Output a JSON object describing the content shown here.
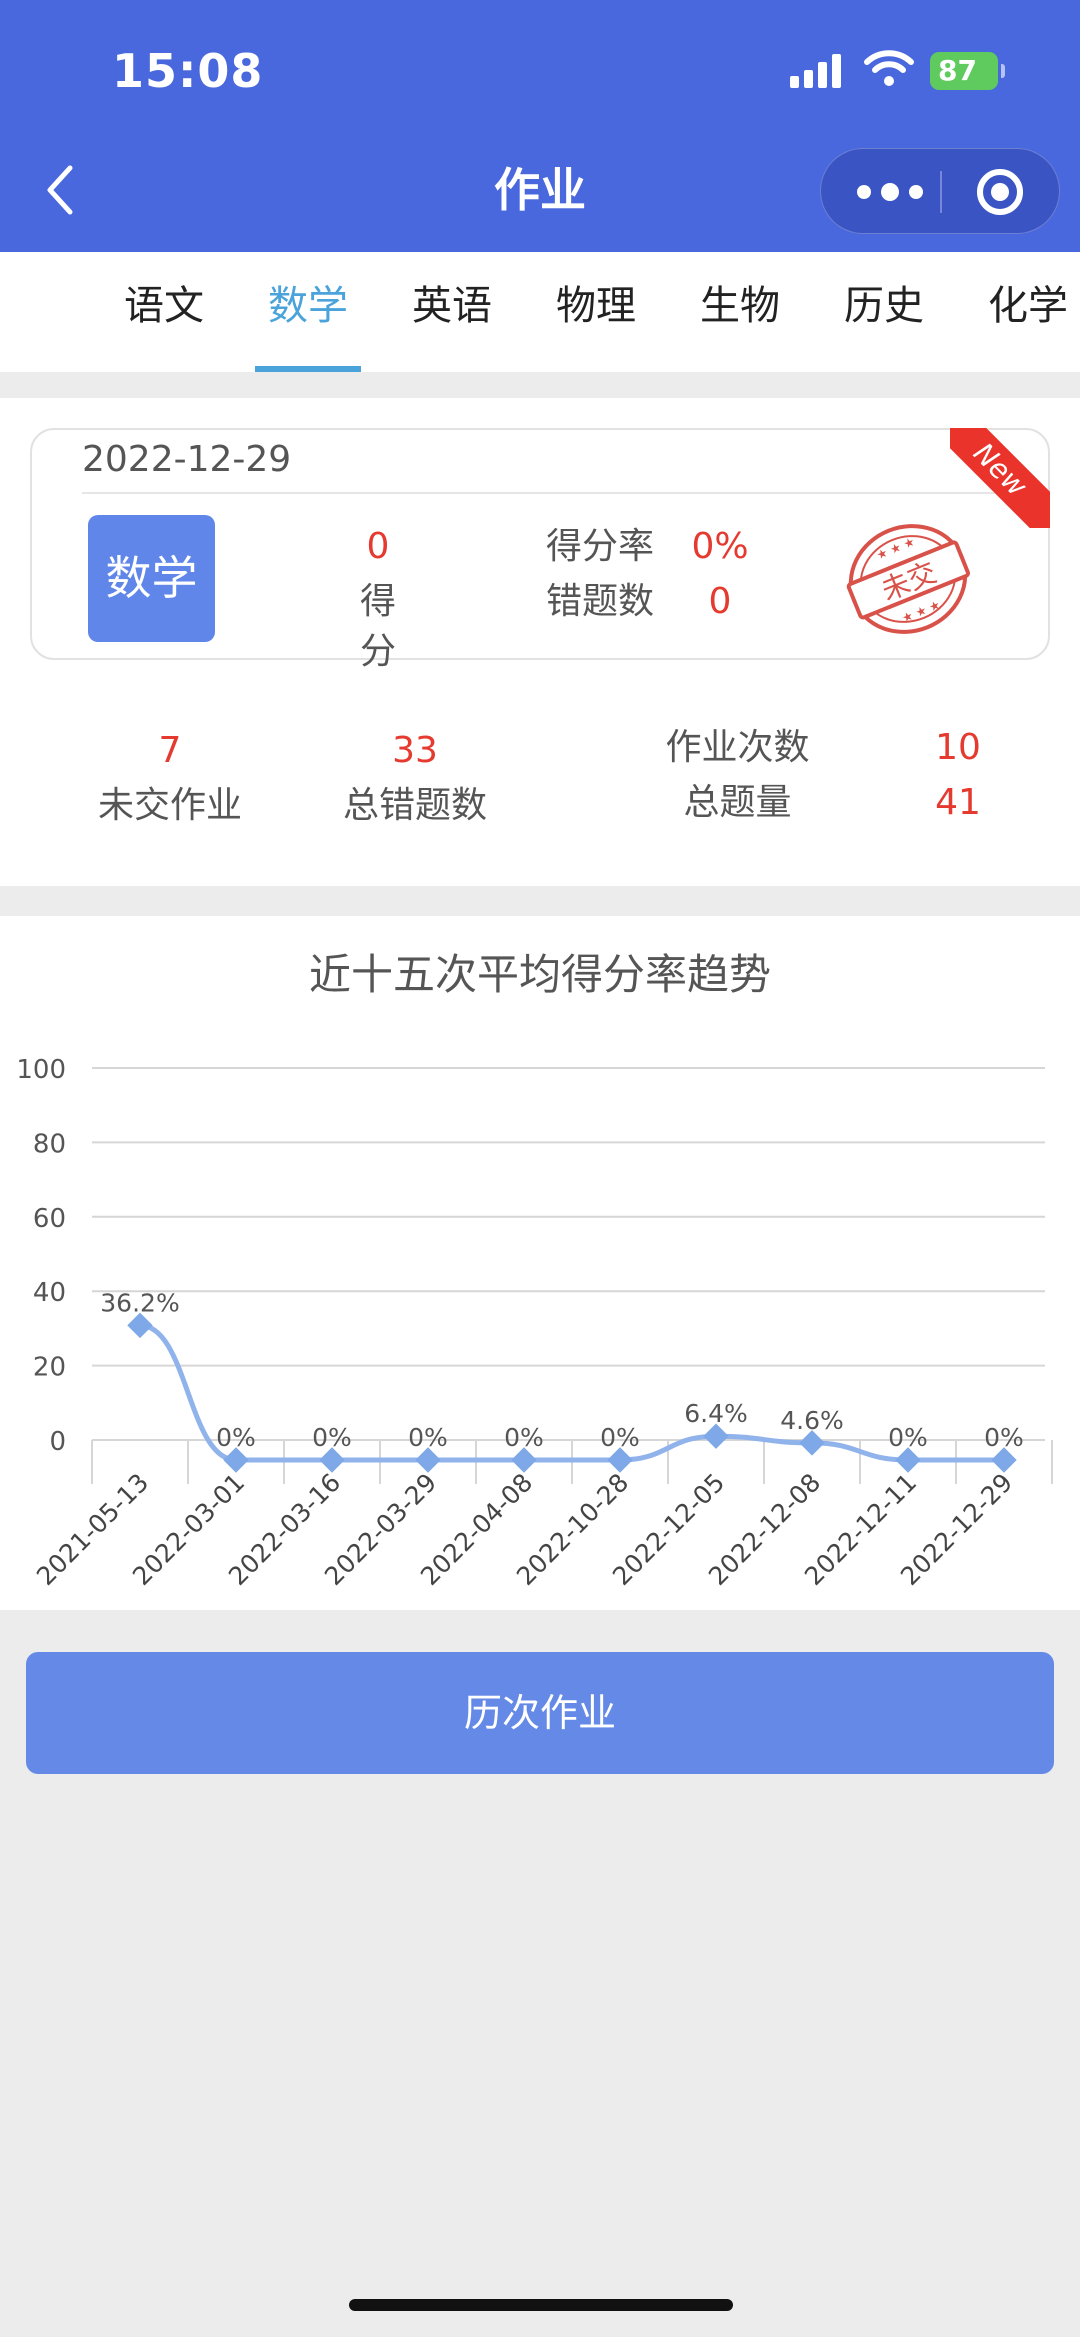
{
  "status_bar": {
    "time": "15:08",
    "battery": "87"
  },
  "header": {
    "title": "作业"
  },
  "tabs": [
    {
      "label": "语文",
      "active": false
    },
    {
      "label": "数学",
      "active": true
    },
    {
      "label": "英语",
      "active": false
    },
    {
      "label": "物理",
      "active": false
    },
    {
      "label": "生物",
      "active": false
    },
    {
      "label": "历史",
      "active": false
    },
    {
      "label": "化学",
      "active": false
    }
  ],
  "homework_card": {
    "date": "2022-12-29",
    "subject": "数学",
    "score_value": "0",
    "score_label": "得分",
    "rate_label": "得分率",
    "rate_value": "0%",
    "wrong_label": "错题数",
    "wrong_value": "0",
    "ribbon": "New",
    "stamp_text": "未交"
  },
  "stats": {
    "unsubmitted_value": "7",
    "unsubmitted_label": "未交作业",
    "total_wrong_value": "33",
    "total_wrong_label": "总错题数",
    "count_label": "作业次数",
    "count_value": "10",
    "total_questions_label": "总题量",
    "total_questions_value": "41"
  },
  "chart_title": "近十五次平均得分率趋势",
  "chart_data": {
    "type": "line",
    "title": "近十五次平均得分率趋势",
    "xlabel": "",
    "ylabel": "",
    "ylim": [
      0,
      100
    ],
    "yticks": [
      0,
      20,
      40,
      60,
      80,
      100
    ],
    "grid": true,
    "categories": [
      "2021-05-13",
      "2022-03-01",
      "2022-03-16",
      "2022-03-29",
      "2022-04-08",
      "2022-10-28",
      "2022-12-05",
      "2022-12-08",
      "2022-12-11",
      "2022-12-29"
    ],
    "values": [
      36.2,
      0,
      0,
      0,
      0,
      0,
      6.4,
      4.6,
      0,
      0
    ],
    "point_labels": [
      "36.2%",
      "0%",
      "0%",
      "0%",
      "0%",
      "0%",
      "6.4%",
      "4.6%",
      "0%",
      "0%"
    ],
    "color": "#8fb3ea"
  },
  "history_button": "历次作业",
  "colors": {
    "primary": "#4a68dd",
    "accent": "#4aa3db",
    "red": "#e53a2f",
    "button": "#6589e6"
  }
}
